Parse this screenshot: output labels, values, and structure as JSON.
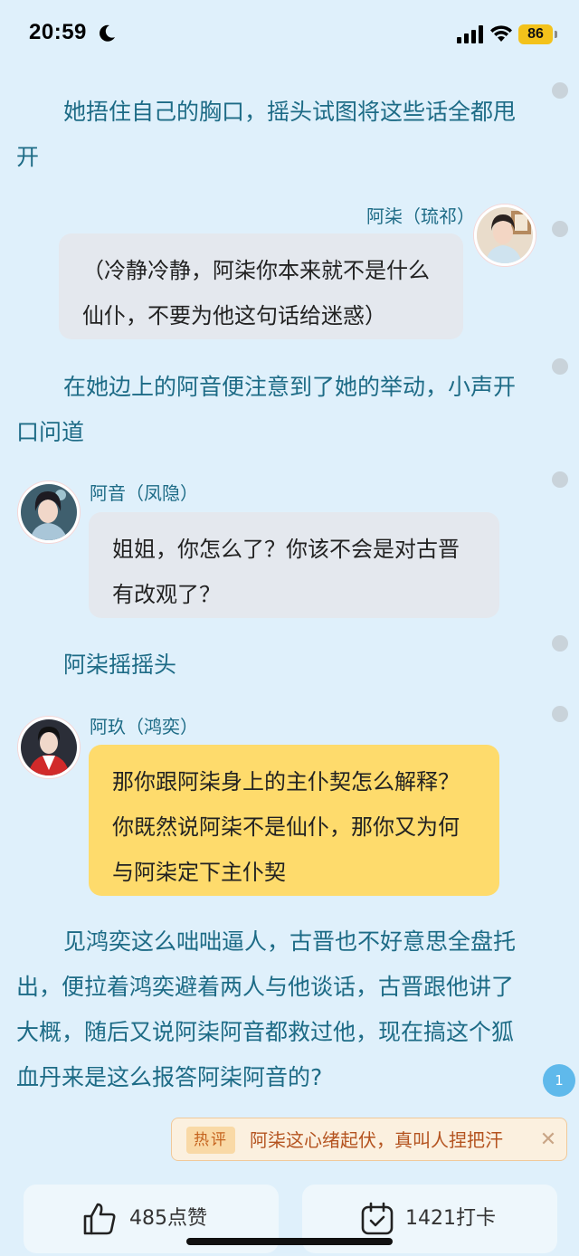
{
  "status_bar": {
    "time": "20:59",
    "battery_level": "86",
    "icons": [
      "moon-icon",
      "cellular-signal-icon",
      "wifi-icon",
      "battery-icon"
    ]
  },
  "content": {
    "narration_1": "她捂住自己的胸口，摇头试图将这些话全都甩开",
    "chat_1": {
      "speaker": "阿柒（琉祁）",
      "text": "（冷静冷静，阿柒你本来就不是什么仙仆，不要为他这句话给迷惑）"
    },
    "narration_2": "在她边上的阿音便注意到了她的举动，小声开口问道",
    "chat_2": {
      "speaker": "阿音（凤隐）",
      "text": "姐姐，你怎么了？你该不会是对古晋有改观了？"
    },
    "narration_3": "阿柒摇摇头",
    "chat_3": {
      "speaker": "阿玖（鸿奕）",
      "text": "那你跟阿柒身上的主仆契怎么解释？你既然说阿柒不是仙仆，那你又为何与阿柒定下主仆契"
    },
    "narration_4": "见鸿奕这么咄咄逼人，古晋也不好意思全盘托出，便拉着鸿奕避着两人与他谈话，古晋跟他讲了大概，随后又说阿柒阿音都救过他，现在搞这个狐血丹来是这么报答阿柒阿音的?"
  },
  "comment_badge": {
    "count": "1"
  },
  "hot_comment": {
    "tag": "热评",
    "text": "阿柒这心绪起伏，真叫人捏把汗"
  },
  "bottom_bar": {
    "like_label": "485点赞",
    "checkin_label": "1421打卡"
  },
  "colors": {
    "background": "#dff0fb",
    "narration": "#1d6b86",
    "bubble_gray": "#e4e8ee",
    "bubble_yellow": "#fedb6c",
    "accent_blue": "#5fb9eb"
  }
}
